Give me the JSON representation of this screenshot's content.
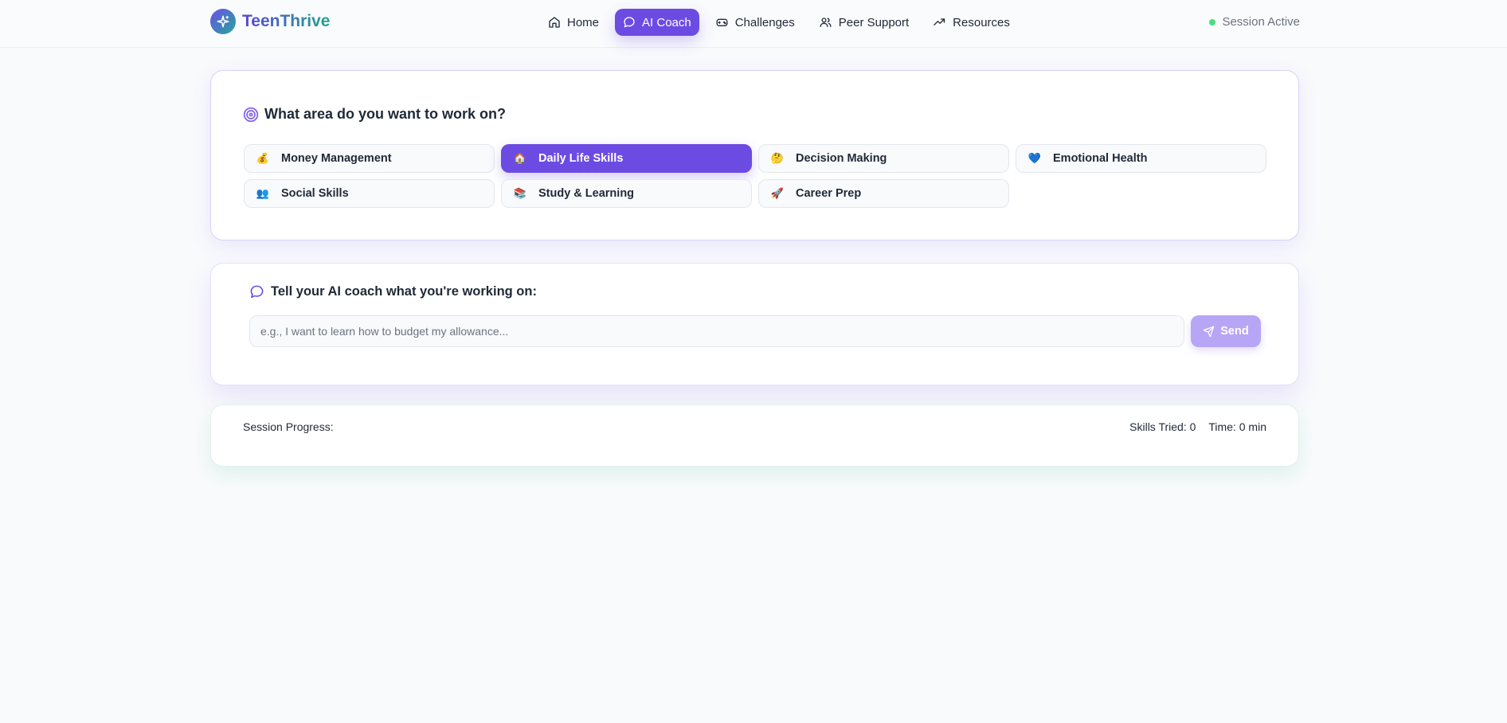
{
  "brand": {
    "name": "TeenThrive",
    "icon": "sparkles-icon"
  },
  "nav": {
    "items": [
      {
        "label": "Home",
        "icon": "home-icon",
        "active": false
      },
      {
        "label": "AI Coach",
        "icon": "chat-bubble-icon",
        "active": true
      },
      {
        "label": "Challenges",
        "icon": "gamepad-icon",
        "active": false
      },
      {
        "label": "Peer Support",
        "icon": "users-icon",
        "active": false
      },
      {
        "label": "Resources",
        "icon": "trending-up-icon",
        "active": false
      }
    ],
    "status": "Session Active"
  },
  "areas": {
    "title": "What area do you want to work on?",
    "items": [
      {
        "label": "Money Management",
        "emoji": "💰",
        "active": false
      },
      {
        "label": "Daily Life Skills",
        "emoji": "🏠",
        "active": true
      },
      {
        "label": "Decision Making",
        "emoji": "🤔",
        "active": false
      },
      {
        "label": "Emotional Health",
        "emoji": "💙",
        "active": false
      },
      {
        "label": "Social Skills",
        "emoji": "👥",
        "active": false
      },
      {
        "label": "Study & Learning",
        "emoji": "📚",
        "active": false
      },
      {
        "label": "Career Prep",
        "emoji": "🚀",
        "active": false
      }
    ]
  },
  "chat": {
    "title": "Tell your AI coach what you're working on:",
    "input_value": "",
    "placeholder": "e.g., I want to learn how to budget my allowance...",
    "send_label": "Send"
  },
  "progress": {
    "label": "Session Progress:",
    "skills": "Skills Tried: 0",
    "time": "Time: 0 min"
  },
  "colors": {
    "accent": "#6c4be3",
    "send_disabled": "#b7a5f5",
    "status_dot": "#4ade80"
  }
}
